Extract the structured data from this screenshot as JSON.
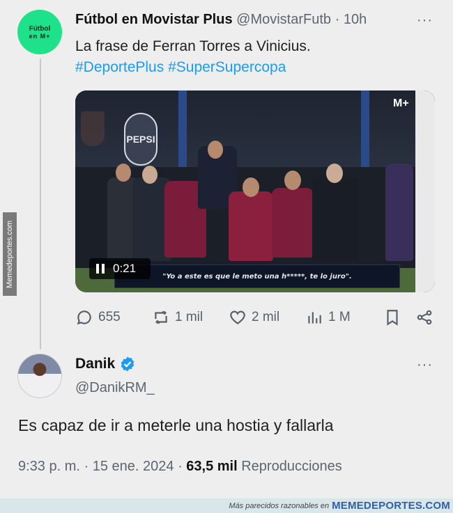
{
  "watermark_side": "Memedeportes.com",
  "tweet1": {
    "avatar_line1": "Fútbol",
    "avatar_line2": "en M+",
    "name": "Fútbol en Movistar Plus",
    "handle": "@MovistarFutb",
    "time": "10h",
    "more": "···",
    "text": "La frase de Ferran Torres a Vinicius.",
    "hashtags": "#DeportePlus #SuperSupercopa",
    "media": {
      "brand": "M+",
      "pepsi": "PEPSI",
      "timestamp": "0:21",
      "subtitle": "\"Yo a este es que le meto una h*****, te lo juro\"."
    },
    "actions": {
      "replies": "655",
      "retweets": "1 mil",
      "likes": "2 mil",
      "views": "1 M"
    }
  },
  "tweet2": {
    "name": "Danik",
    "handle": "@DanikRM_",
    "more": "···",
    "text": "Es capaz de ir a meterle una hostia y fallarla",
    "time": "9:33 p. m.",
    "date": "15 ene. 2024",
    "views_count": "63,5 mil",
    "views_label": "Reproducciones"
  },
  "footer": {
    "small": "Más parecidos razonables en",
    "brand": "MEMEDEPORTES.COM"
  },
  "colors": {
    "accent": "#1d9bf0",
    "avatar_green": "#1de28a",
    "muted": "#5b6670"
  }
}
